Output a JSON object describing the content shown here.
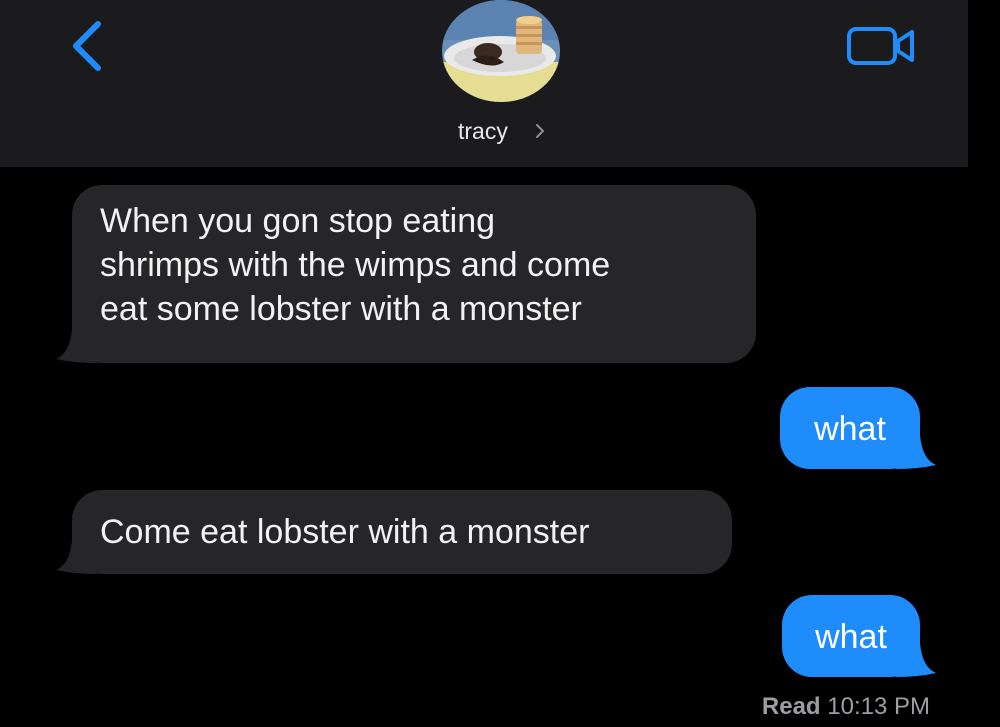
{
  "header": {
    "contact_name": "tracy",
    "avatar": "contact-photo",
    "back_icon": "chevron-left-icon",
    "video_icon": "video-camera-icon",
    "chevron": "chevron-right-icon"
  },
  "messages": [
    {
      "sender": "contact",
      "text": "When you gon stop eating\nshrimps with the wimps and come\neat some lobster with a monster"
    },
    {
      "sender": "me",
      "text": "what"
    },
    {
      "sender": "contact",
      "text": "Come eat lobster with a monster"
    },
    {
      "sender": "me",
      "text": "what"
    }
  ],
  "receipt": {
    "label": "Read",
    "time": "10:13 PM"
  },
  "colors": {
    "accent": "#1e8cfb",
    "incoming_bubble": "#262628",
    "header_bg": "#1b1b1d",
    "background": "#000000"
  }
}
